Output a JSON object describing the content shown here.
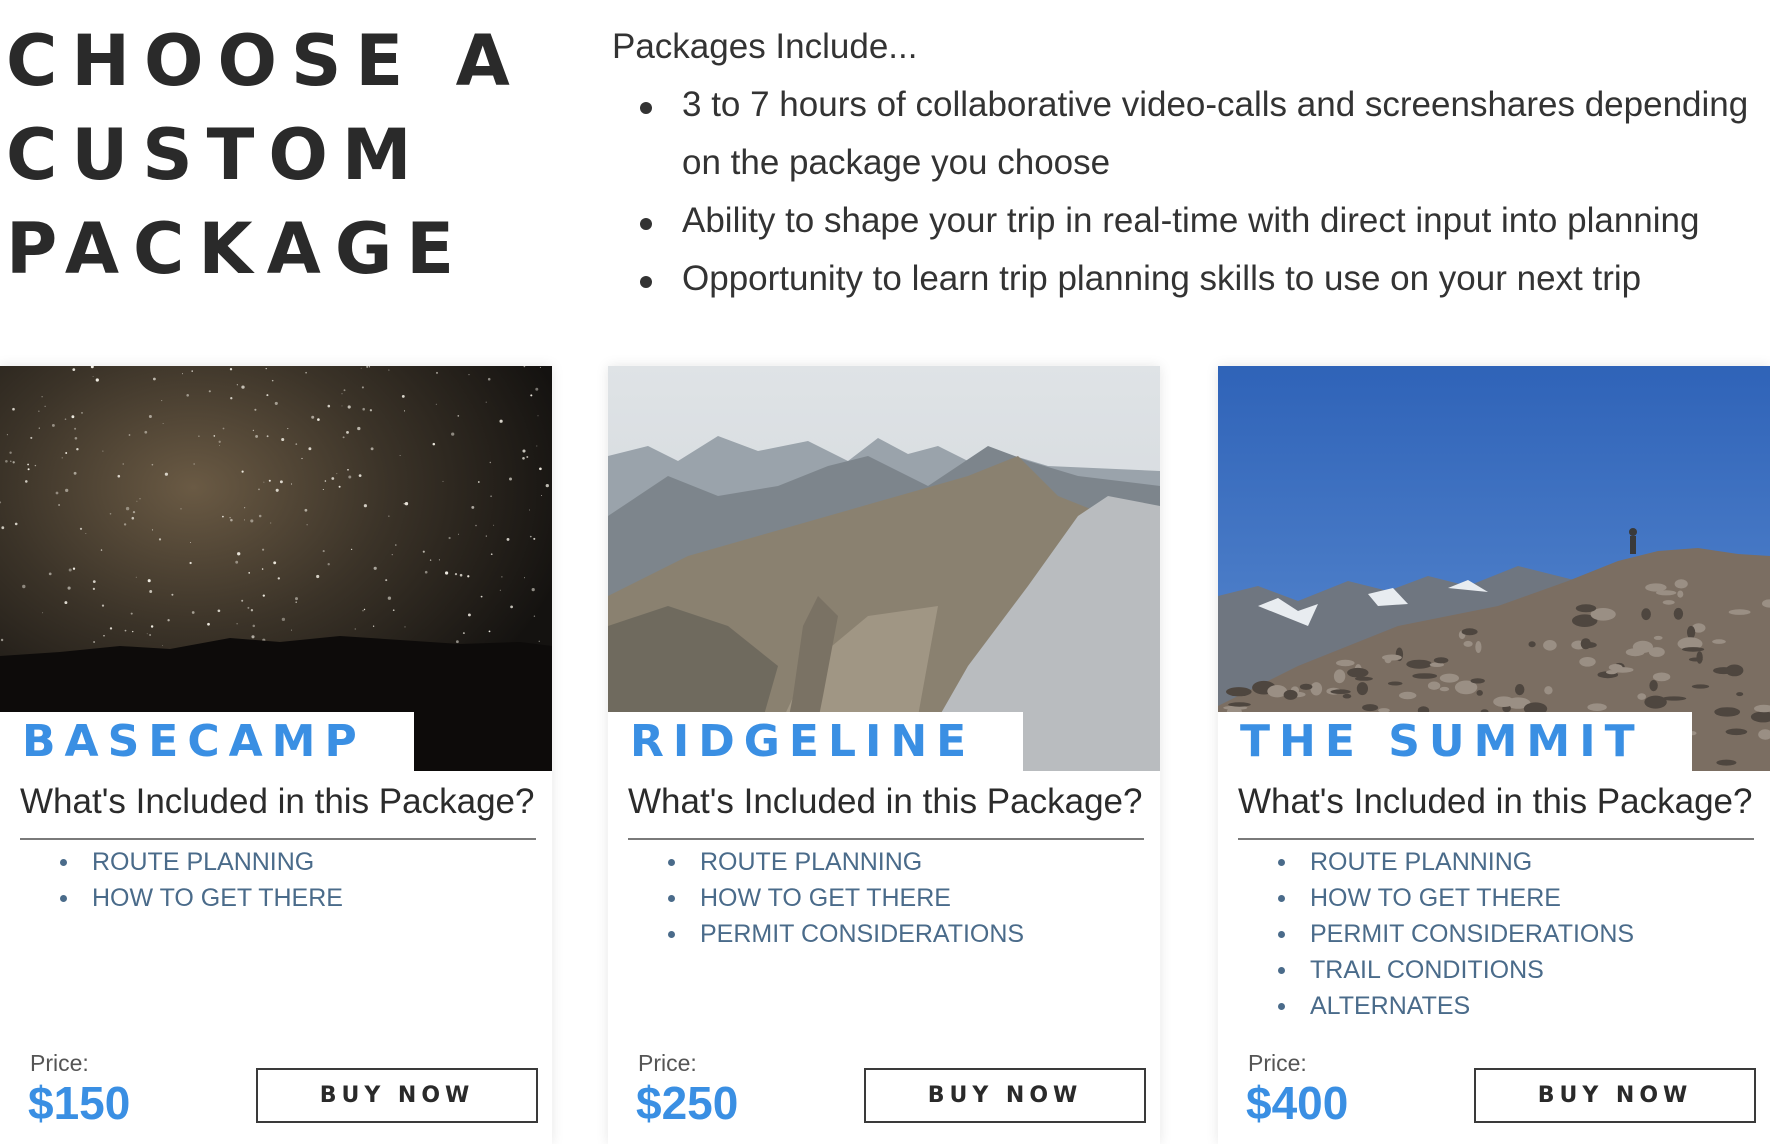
{
  "heading": "CHOOSE A CUSTOM PACKAGE",
  "includes": {
    "title": "Packages Include...",
    "items": [
      "3 to 7 hours of collaborative video-calls and screenshares depending on the package you choose",
      "Ability to shape your trip in real-time with direct input into planning",
      "Opportunity to learn trip planning skills to use on your next trip"
    ]
  },
  "colors": {
    "accent": "#3a8fe3",
    "feature_text": "#4a6b8a",
    "heading": "#2a2a2a"
  },
  "packages": [
    {
      "name": "BASECAMP",
      "image": "night-sky-milky-way",
      "question": "What's Included in this Package?",
      "features": [
        "ROUTE PLANNING",
        "HOW TO GET THERE"
      ],
      "price_label": "Price:",
      "price": "$150",
      "button": "BUY NOW"
    },
    {
      "name": "RIDGELINE",
      "image": "mountain-ridgeline",
      "question": "What's Included in this Package?",
      "features": [
        "ROUTE PLANNING",
        "HOW TO GET THERE",
        "PERMIT CONSIDERATIONS"
      ],
      "price_label": "Price:",
      "price": "$250",
      "button": "BUY NOW"
    },
    {
      "name": "THE SUMMIT",
      "image": "rocky-summit-hiker",
      "question": "What's Included in this Package?",
      "features": [
        "ROUTE PLANNING",
        "HOW TO GET THERE",
        "PERMIT CONSIDERATIONS",
        "TRAIL CONDITIONS",
        "ALTERNATES"
      ],
      "price_label": "Price:",
      "price": "$400",
      "button": "BUY NOW"
    }
  ]
}
